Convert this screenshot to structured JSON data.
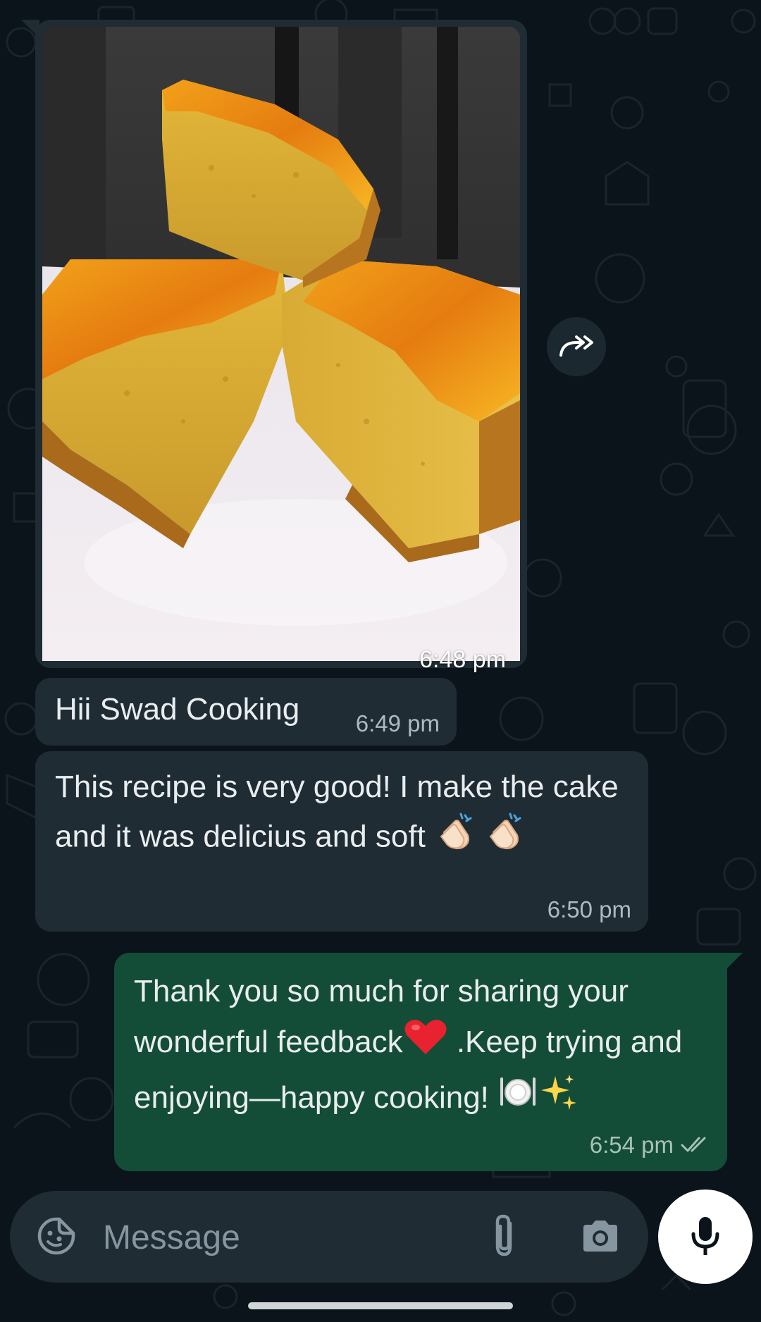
{
  "messages": {
    "image_message": {
      "time": "6:48 pm",
      "photo_icon": "cake-photo"
    },
    "greeting": {
      "text": "Hii Swad Cooking",
      "time": "6:49 pm"
    },
    "feedback": {
      "text": "This recipe is very good! I make the cake and it was delicius and soft",
      "emoji_1": "clapping-hands",
      "emoji_2": "clapping-hands",
      "time": "6:50 pm"
    },
    "reply": {
      "text_part1": "Thank you so much for sharing your wonderful feedback",
      "heart_emoji": "red-heart",
      "text_part2": " .Keep trying and enjoying—happy cooking! ",
      "emoji_plate": "fork-and-knife-with-plate",
      "emoji_sparkles": "sparkles",
      "time": "6:54 pm",
      "status_icon": "double-check-icon"
    }
  },
  "forward_button": {
    "icon": "forward-icon"
  },
  "composer": {
    "placeholder": "Message",
    "sticker_icon": "sticker-icon",
    "attach_icon": "paperclip-icon",
    "camera_icon": "camera-icon",
    "mic_icon": "microphone-icon"
  },
  "colors": {
    "background": "#0b141a",
    "incoming_bubble": "#1f2c34",
    "outgoing_bubble": "#144d37",
    "text": "#e9edef",
    "meta_text": "#aebac1"
  }
}
